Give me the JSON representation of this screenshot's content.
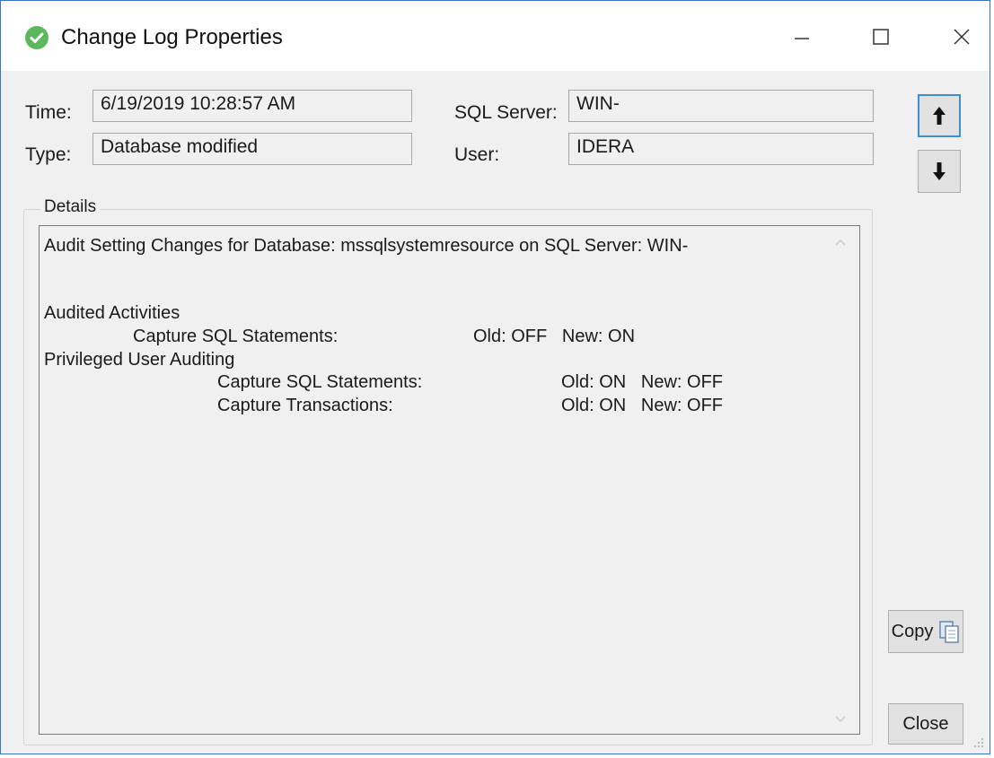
{
  "window": {
    "title": "Change Log Properties",
    "icon": "check-circle-icon",
    "controls": {
      "minimize": "minimize-icon",
      "maximize": "maximize-icon",
      "close": "close-icon"
    }
  },
  "fields": {
    "time_label": "Time:",
    "time_value": "6/19/2019 10:28:57 AM",
    "type_label": "Type:",
    "type_value": "Database modified",
    "sql_server_label": "SQL Server:",
    "sql_server_value": "WIN-",
    "user_label": "User:",
    "user_value": "IDERA"
  },
  "navigation": {
    "up_icon": "arrow-up-icon",
    "down_icon": "arrow-down-icon"
  },
  "details": {
    "group_label": "Details",
    "lines": [
      "Audit Setting Changes for Database: mssqlsystemresource on SQL Server: WIN-",
      "Audited Activities",
      "Capture SQL Statements:",
      "Old: OFF   New: ON",
      "Privileged User Auditing",
      "Capture SQL Statements:",
      "Old: ON   New: OFF",
      "Capture Transactions:",
      "Old: ON   New: OFF"
    ]
  },
  "buttons": {
    "copy_label": "Copy",
    "copy_icon": "clipboard-icon",
    "close_label": "Close"
  },
  "colors": {
    "accent": "#3a8fd8",
    "window_border": "#3b74c9",
    "status_icon": "#5cb85c"
  }
}
